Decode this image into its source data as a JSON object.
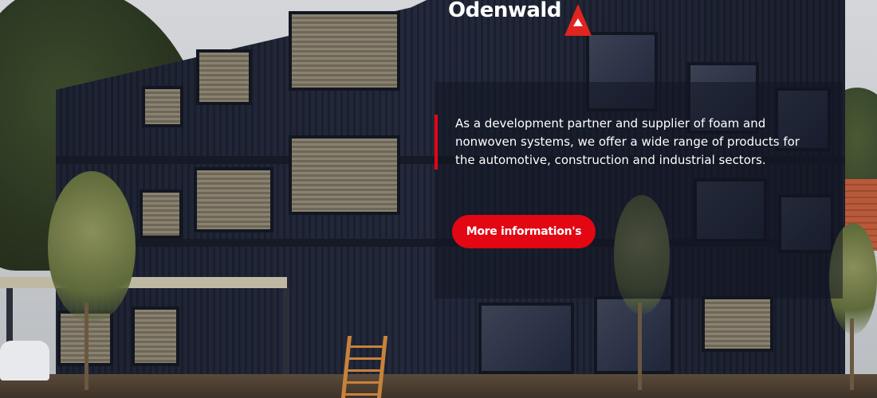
{
  "hero": {
    "logo": {
      "text": "Odenwald",
      "icon": "odenwald-triangle-logo-icon",
      "accent_color": "#e30613"
    },
    "intro_text": "As a development partner and supplier of foam and nonwoven systems, we offer a wide range of products for the automotive, construction and industrial sectors.",
    "cta_label": "More information's",
    "accent_color": "#e30613",
    "background_image": "building-exterior-photo"
  }
}
